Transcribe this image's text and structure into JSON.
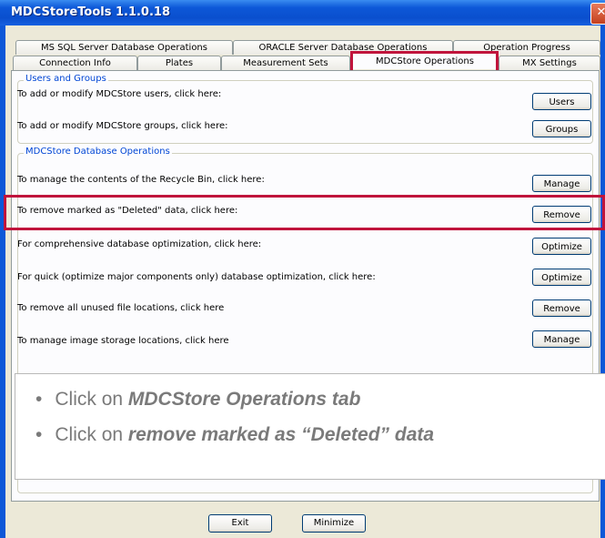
{
  "window": {
    "title": "MDCStoreTools 1.1.0.18",
    "close_label": "✕"
  },
  "tabs": {
    "row1": [
      {
        "label": "MS SQL Server Database Operations"
      },
      {
        "label": "ORACLE Server Database Operations"
      },
      {
        "label": "Operation Progress"
      }
    ],
    "row2": [
      {
        "label": "Connection Info"
      },
      {
        "label": "Plates"
      },
      {
        "label": "Measurement Sets"
      },
      {
        "label": "MDCStore Operations",
        "active": true
      },
      {
        "label": "MX Settings"
      }
    ]
  },
  "groups": {
    "users_groups": {
      "title": "Users and Groups",
      "rows": [
        {
          "label": "To add or modify MDCStore users, click here:",
          "button": "Users"
        },
        {
          "label": "To add or modify MDCStore groups, click here:",
          "button": "Groups"
        }
      ]
    },
    "db_ops": {
      "title": "MDCStore Database Operations",
      "rows": [
        {
          "label": "To manage the contents of the Recycle Bin, click here:",
          "button": "Manage"
        },
        {
          "label": "To remove marked as \"Deleted\" data, click here:",
          "button": "Remove"
        },
        {
          "label": "For comprehensive database optimization, click here:",
          "button": "Optimize"
        },
        {
          "label": "For quick (optimize major components only) database optimization, click here:",
          "button": "Optimize"
        },
        {
          "label": "To remove all unused file locations, click here",
          "button": "Remove"
        },
        {
          "label": "To manage image storage locations, click here",
          "button": "Manage"
        }
      ]
    }
  },
  "callout": {
    "items": [
      {
        "prefix": "Click on ",
        "emphasis": "MDCStore Operations tab"
      },
      {
        "prefix": "Click on ",
        "emphasis": "remove marked as “Deleted” data"
      }
    ]
  },
  "footer": {
    "exit_label": "Exit",
    "minimize_label": "Minimize"
  },
  "colors": {
    "highlight": "#c0143c",
    "titlebar": "#0d58d8",
    "legend_text": "#0046d5"
  }
}
